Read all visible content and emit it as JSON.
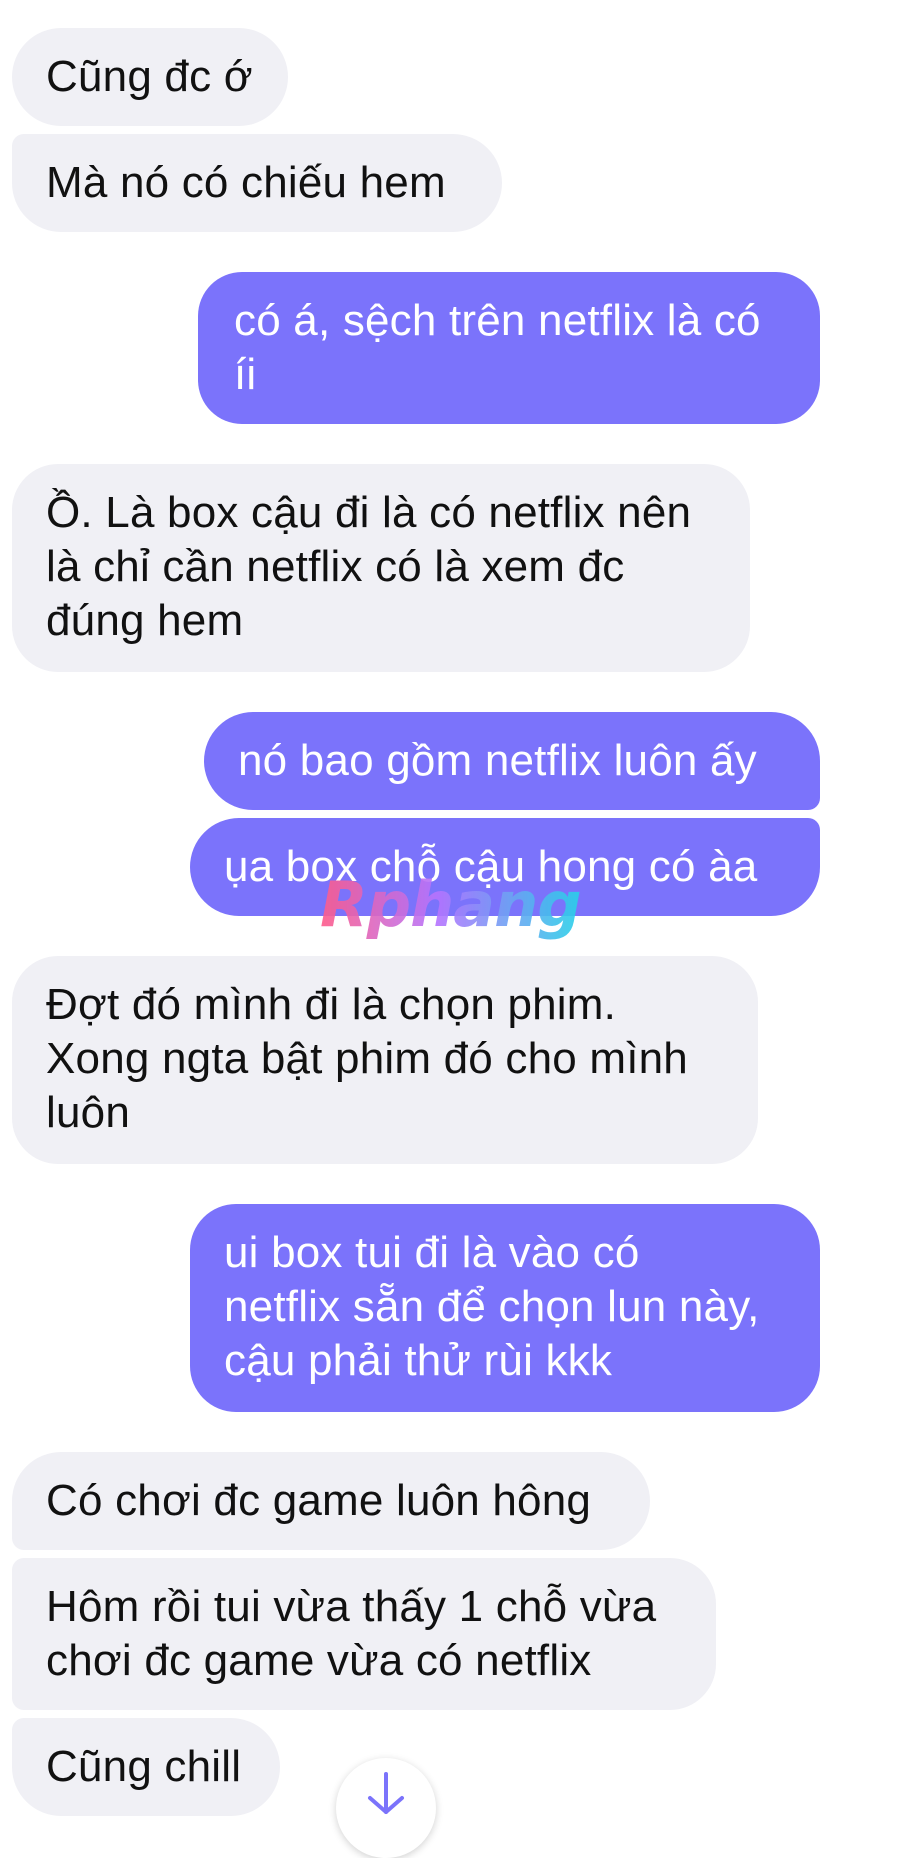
{
  "messages": [
    {
      "text": "Cũng đc ớ",
      "direction": "incoming"
    },
    {
      "text": "Mà nó có chiếu hem",
      "direction": "incoming"
    },
    {
      "text": "có á, sệch trên netflix là có\níi",
      "direction": "outgoing"
    },
    {
      "text": "Ồ. Là box cậu đi là có netflix nên\nlà chỉ cần netflix có là xem đc\nđúng hem",
      "direction": "incoming"
    },
    {
      "text": "nó bao gồm netflix luôn ấy",
      "direction": "outgoing"
    },
    {
      "text": "ụa box chỗ cậu hong có àa",
      "direction": "outgoing"
    },
    {
      "text": "Đợt đó mình đi là chọn phim.\nXong ngta bật phim đó cho mình\nluôn",
      "direction": "incoming"
    },
    {
      "text": "ui box tui đi là vào có\nnetflix sẵn để chọn lun này,\ncậu phải thử rùi kkk",
      "direction": "outgoing"
    },
    {
      "text": "Có chơi đc game luôn hông",
      "direction": "incoming"
    },
    {
      "text": "Hôm rồi tui vừa thấy 1 chỗ vừa\nchơi đc game vừa có netflix",
      "direction": "incoming"
    },
    {
      "text": "Cũng chill",
      "direction": "incoming"
    }
  ],
  "watermark": {
    "text": "Rphang"
  },
  "scroll_button": {
    "icon": "arrow-down-icon"
  },
  "colors": {
    "incoming_bubble": "#f0f0f5",
    "outgoing_bubble": "#7b73fb",
    "incoming_text": "#111111",
    "outgoing_text": "#ffffff",
    "arrow": "#7b73fb"
  }
}
